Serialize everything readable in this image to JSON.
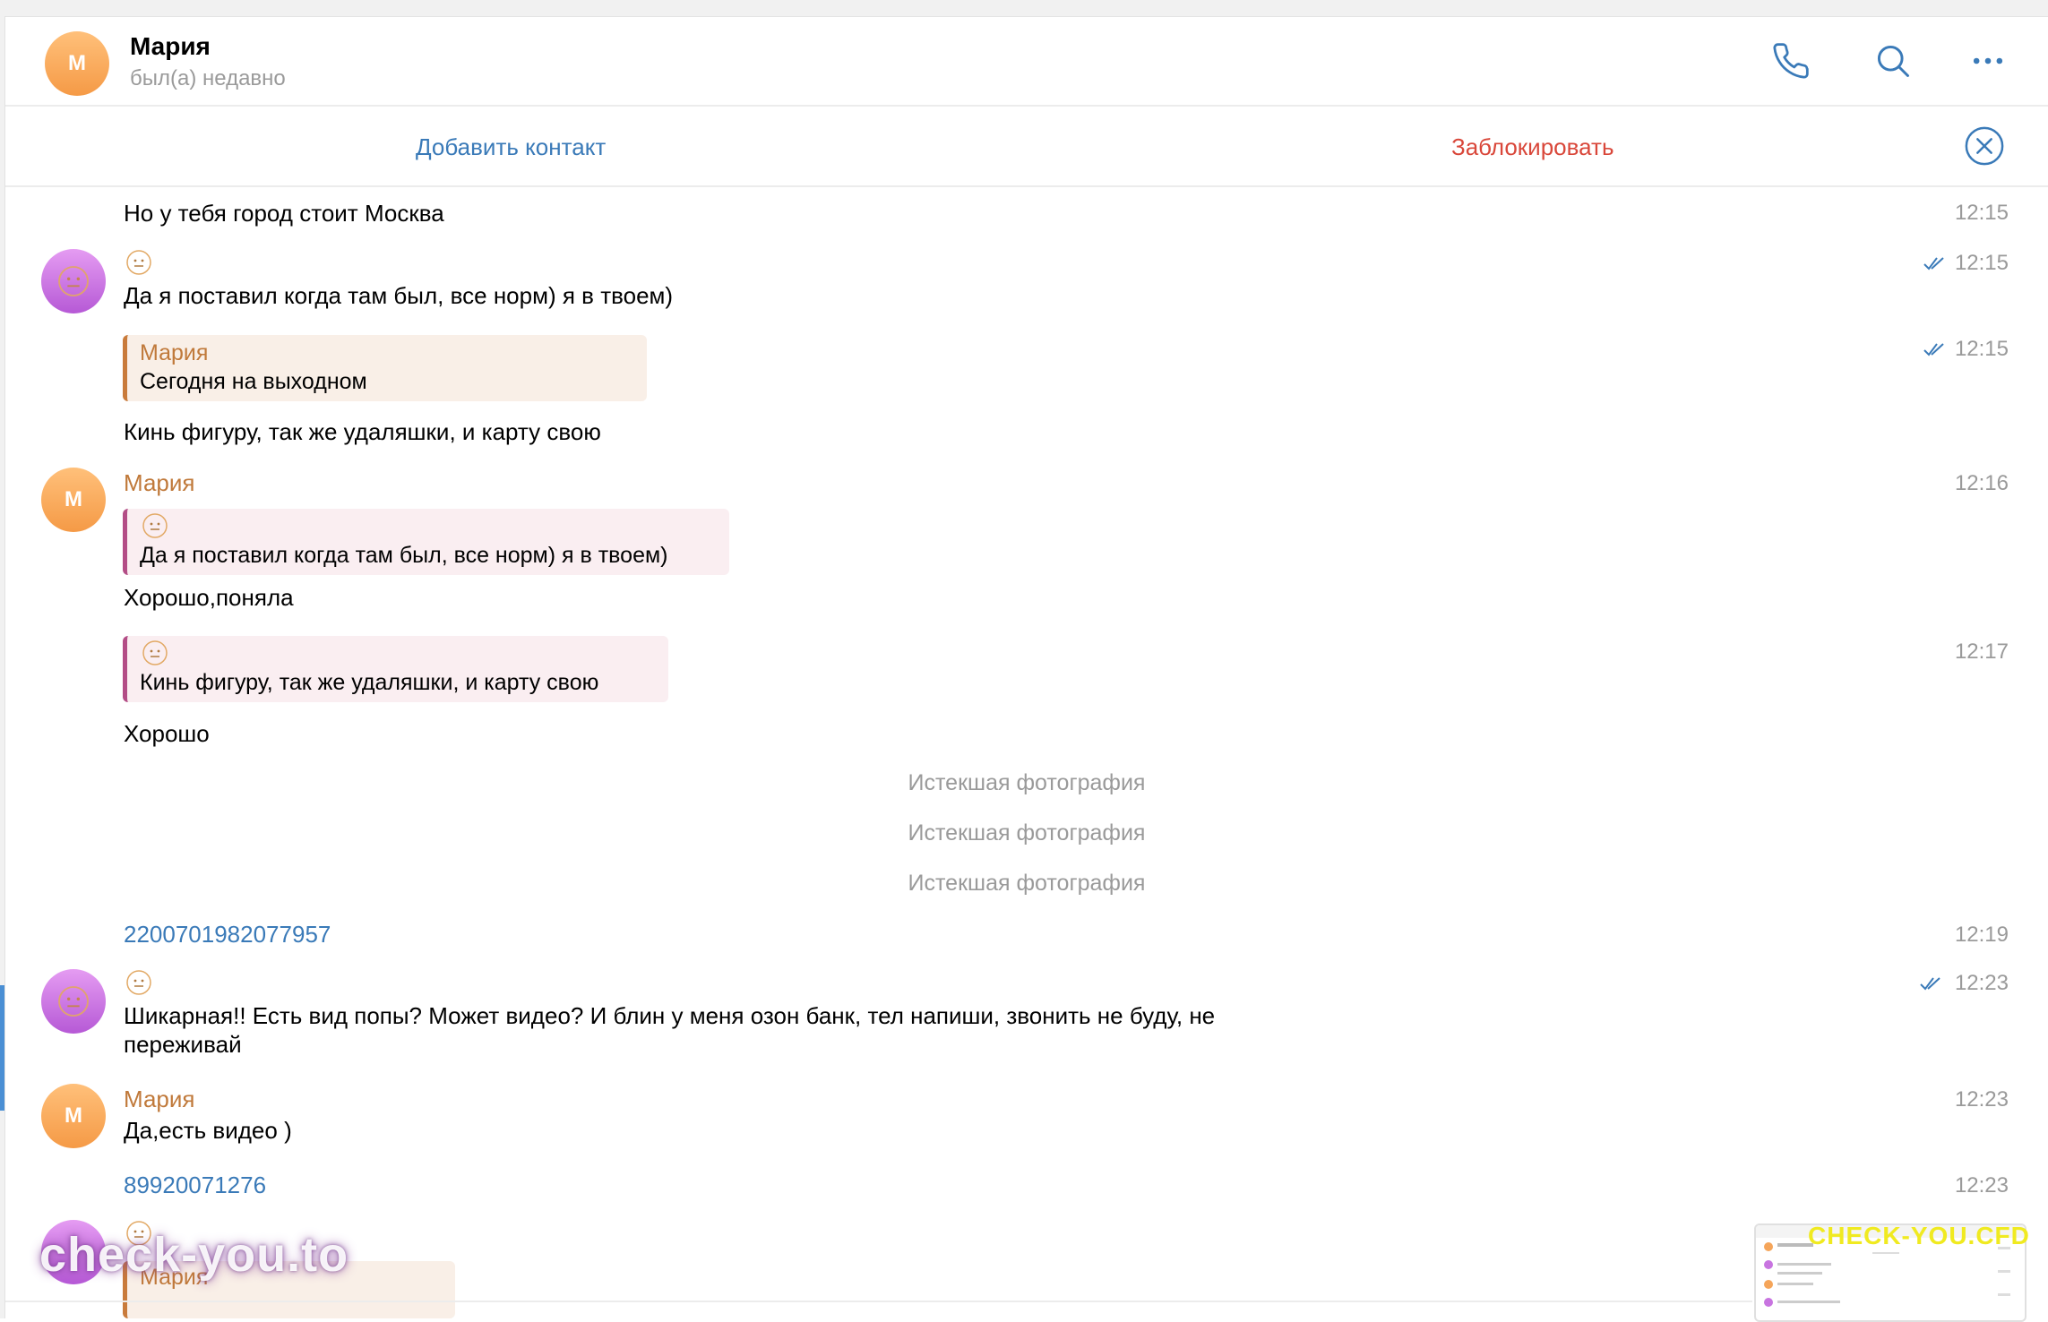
{
  "header": {
    "avatar_letter": "M",
    "contact_name": "Мария",
    "status": "был(а) недавно",
    "icons": [
      "phone-icon",
      "search-icon",
      "more-icon"
    ]
  },
  "action_bar": {
    "add_contact": "Добавить контакт",
    "block": "Заблокировать",
    "close_icon": "close-circle-icon"
  },
  "messages": {
    "m1": {
      "text": "Но у тебя город стоит Москва",
      "time": "12:15"
    },
    "m2": {
      "text": "Да я поставил когда там был, все норм) я в твоем)",
      "time": "12:15"
    },
    "m3": {
      "quote_name": "Мария",
      "quote_text": "Сегодня на выходном",
      "text": "Кинь фигуру,  так же удаляшки,  и карту свою",
      "time": "12:15"
    },
    "m4": {
      "sender": "Мария",
      "quote_text": "Да я поставил когда там был, все норм) я в твоем)",
      "text": "Хорошо,поняла",
      "time": "12:16"
    },
    "m5": {
      "quote_text": "Кинь фигуру,  так же удаляшки,  и карту свою",
      "text": "Хорошо",
      "time": "12:17"
    },
    "service1": "Истекшая фотография",
    "service2": "Истекшая фотография",
    "service3": "Истекшая фотография",
    "m6": {
      "text": "2200701982077957",
      "time": "12:19"
    },
    "m7": {
      "text_line1": "Шикарная!! Есть вид попы? Может видео? И блин у меня озон банк, тел напиши, звонить не буду, не",
      "text_line2": "переживай",
      "time": "12:23"
    },
    "m8": {
      "sender": "Мария",
      "text": "Да,есть видео )",
      "time": "12:23"
    },
    "m9": {
      "text": "89920071276",
      "time": "12:23"
    },
    "m10": {
      "quote_name": "Мария"
    }
  },
  "watermarks": {
    "left": "check-you.to",
    "right": "CHECK-YOU.CFD"
  },
  "colors": {
    "accent_blue": "#3a7ab8",
    "block_red": "#d9473a",
    "sender_orange": "#c0793a",
    "time_gray": "#9a9a9a"
  }
}
